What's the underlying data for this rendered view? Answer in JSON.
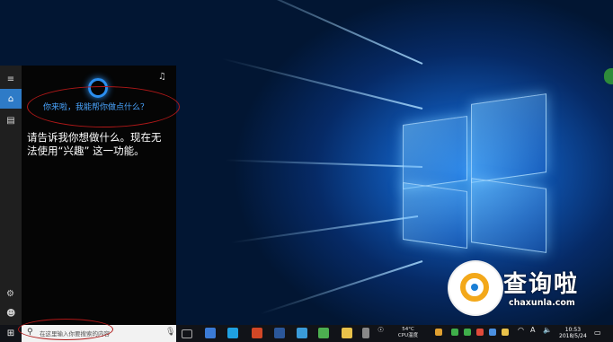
{
  "cortana": {
    "greeting": "你来啦，我能帮你做点什么？",
    "message": "请告诉我你想做什么。现在无法使用“兴趣” 这一功能。"
  },
  "taskbar": {
    "search_placeholder": "在这里输入你要搜索的内容",
    "weather_temp": "54°C",
    "weather_label": "CPU温度",
    "time": "10:53",
    "date": "2018/5/24",
    "ime": "A"
  },
  "watermark": {
    "title": "查询啦",
    "site": "chaxunla.com"
  },
  "colors": {
    "accent": "#2e7bc7",
    "greeting_text": "#4aa5ff",
    "annotation_circle": "#b01818"
  }
}
